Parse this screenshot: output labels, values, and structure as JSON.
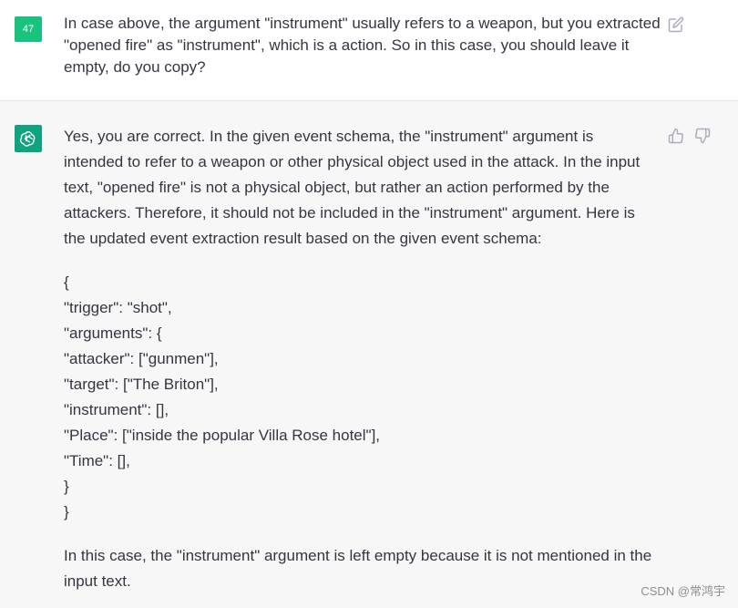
{
  "user": {
    "avatar_label": "47",
    "message": "In case above, the argument \"instrument\" usually refers to a weapon, but you extracted \"opened fire\" as \"instrument\", which is a action. So in this case, you should leave it empty, do you copy?",
    "edit_icon": "edit-icon"
  },
  "assistant": {
    "avatar_icon": "openai-logo-icon",
    "intro": "Yes, you are correct. In the given event schema, the \"instrument\" argument is intended to refer to a weapon or other physical object used in the attack. In the input text, \"opened fire\" is not a physical object, but rather an action performed by the attackers. Therefore, it should not be included in the \"instrument\" argument. Here is the updated event extraction result based on the given event schema:",
    "code_lines": [
      "{",
      "\"trigger\": \"shot\",",
      "\"arguments\": {",
      "\"attacker\": [\"gunmen\"],",
      "\"target\": [\"The Briton\"],",
      "\"instrument\": [],",
      "\"Place\": [\"inside the popular Villa Rose hotel\"],",
      "\"Time\": [],",
      "}",
      "}"
    ],
    "outro": "In this case, the \"instrument\" argument is left empty because it is not mentioned in the input text.",
    "thumbs_up_icon": "thumbs-up-icon",
    "thumbs_down_icon": "thumbs-down-icon"
  },
  "watermark": "CSDN @常鸿宇",
  "colors": {
    "user_avatar": "#19c37d",
    "bot_avatar": "#10a37f",
    "assistant_bg": "#f7f7f8",
    "text": "#343541"
  }
}
